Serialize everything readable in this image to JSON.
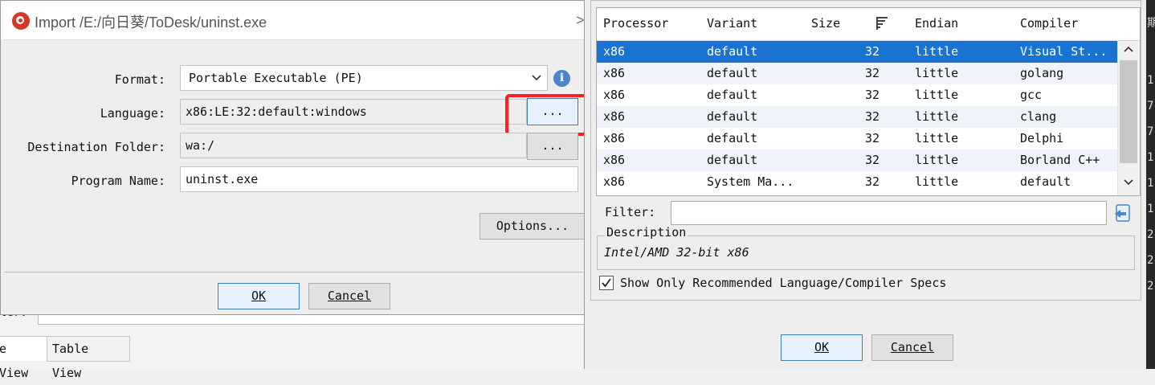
{
  "background_app": {
    "filter_label": "ter:",
    "tabs": [
      "e View",
      "Table View"
    ]
  },
  "dark_strip_chars": [
    "期",
    "1",
    "7",
    "7",
    "1",
    "1",
    "1",
    "2",
    "2",
    "2"
  ],
  "import_dialog": {
    "title": "Import /E:/向日葵/ToDesk/uninst.exe",
    "close_glyph": ">",
    "format_label": "Format:",
    "format_value": "Portable Executable (PE)",
    "language_label": "Language:",
    "language_value": "x86:LE:32:default:windows",
    "browse_label": "...",
    "destination_label": "Destination Folder:",
    "destination_value": "wa:/",
    "program_name_label": "Program Name:",
    "program_name_value": "uninst.exe",
    "options_label": "Options...",
    "ok_label": "OK",
    "cancel_label": "Cancel",
    "info_glyph": "i"
  },
  "language_dialog": {
    "columns": [
      "Processor",
      "Variant",
      "Size",
      "Endian",
      "Compiler"
    ],
    "rows": [
      {
        "processor": "x86",
        "variant": "default",
        "size": "32",
        "endian": "little",
        "compiler": "Visual St..."
      },
      {
        "processor": "x86",
        "variant": "default",
        "size": "32",
        "endian": "little",
        "compiler": "golang"
      },
      {
        "processor": "x86",
        "variant": "default",
        "size": "32",
        "endian": "little",
        "compiler": "gcc"
      },
      {
        "processor": "x86",
        "variant": "default",
        "size": "32",
        "endian": "little",
        "compiler": "clang"
      },
      {
        "processor": "x86",
        "variant": "default",
        "size": "32",
        "endian": "little",
        "compiler": "Delphi"
      },
      {
        "processor": "x86",
        "variant": "default",
        "size": "32",
        "endian": "little",
        "compiler": "Borland C++"
      },
      {
        "processor": "x86",
        "variant": "System Ma...",
        "size": "32",
        "endian": "little",
        "compiler": "default"
      }
    ],
    "selected_row": 0,
    "filter_label": "Filter:",
    "filter_value": "",
    "description_legend": "Description",
    "description_text": "Intel/AMD 32-bit x86",
    "recommend_checked": true,
    "recommend_label": "Show Only Recommended Language/Compiler Specs",
    "ok_label": "OK",
    "cancel_label": "Cancel"
  },
  "colors": {
    "selection": "#1873d3",
    "highlight": "#ff2020",
    "info_icon": "#4a86c8",
    "logo": "#d23a26"
  }
}
